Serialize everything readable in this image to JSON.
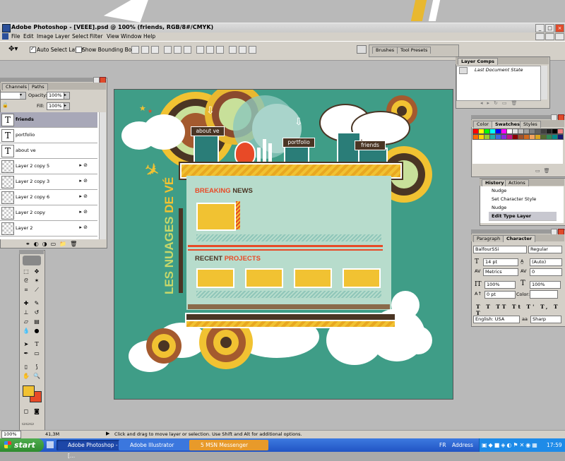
{
  "window": {
    "title": "Adobe Photoshop - [VEEE].psd @ 100% (friends, RGB/8#/CMYK)"
  },
  "menu": [
    "File",
    "Edit",
    "Image",
    "Layer",
    "Select",
    "Filter",
    "View",
    "Window",
    "Help"
  ],
  "options": {
    "auto_select": "Auto Select Layer",
    "show_bounding": "Show Bounding Box",
    "wells": [
      "Brushes",
      "Tool Presets"
    ]
  },
  "layers_palette": {
    "tabs": [
      "Channels",
      "Paths"
    ],
    "opacity_label": "Opacity:",
    "opacity_value": "100%",
    "fill_label": "Fill:",
    "fill_value": "100%",
    "rows": [
      {
        "name": "friends",
        "type": "T"
      },
      {
        "name": "portfolio",
        "type": "T"
      },
      {
        "name": "about ve",
        "type": "T"
      },
      {
        "name": "Layer 2 copy 5",
        "type": "img"
      },
      {
        "name": "Layer 2 copy 3",
        "type": "img"
      },
      {
        "name": "Layer 2 copy 6",
        "type": "img"
      },
      {
        "name": "Layer 2 copy",
        "type": "img"
      },
      {
        "name": "Layer 2",
        "type": "img"
      }
    ]
  },
  "layer_comps": {
    "title": "Layer Comps",
    "item": "Last Document State"
  },
  "swatches": {
    "tabs": [
      "Color",
      "Swatches",
      "Styles"
    ],
    "colors": [
      "#ff0000",
      "#ffff00",
      "#00ff00",
      "#00ffff",
      "#0000ff",
      "#ff00ff",
      "#ffffff",
      "#e0e0e0",
      "#c0c0c0",
      "#a0a0a0",
      "#808080",
      "#606060",
      "#404040",
      "#202020",
      "#000000",
      "#f08080",
      "#ff6a00",
      "#ffd700",
      "#9acd32",
      "#20b2aa",
      "#4169e1",
      "#8a2be2",
      "#c71585",
      "#8b0000",
      "#a0522d",
      "#d2691e",
      "#f4a460",
      "#daa520",
      "#556b2f",
      "#2e8b57",
      "#008b8b",
      "#191970"
    ]
  },
  "history": {
    "tabs": [
      "History",
      "Actions"
    ],
    "items": [
      "Nudge",
      "Set Character Style",
      "Nudge",
      "Edit Type Layer"
    ]
  },
  "character": {
    "tabs": [
      "Paragraph",
      "Character"
    ],
    "font": "BalfourSSi",
    "style": "Regular",
    "size": "14 pt",
    "leading": "(Auto)",
    "kerning": "Metrics",
    "tracking": "0",
    "vscale": "100%",
    "hscale": "100%",
    "baseline": "0 pt",
    "color_label": "Color:",
    "lang": "English: USA",
    "aa": "Sharp"
  },
  "artwork": {
    "vertical_text_a": "LES NUAGES ",
    "vertical_text_b": "DE VÉ",
    "breaking_a": "BREAKING ",
    "breaking_b": "NEWS",
    "recent_a": "RECENT ",
    "recent_b": "PROJECTS",
    "nav": [
      "about ve",
      "portfolio",
      "friends"
    ]
  },
  "status": {
    "zoom": "100%",
    "size": "41,3M",
    "hint": "Click and drag to move layer or selection.  Use Shift and Alt for additional options."
  },
  "taskbar": {
    "start": "start",
    "tasks": [
      "Adobe Photoshop - [...",
      "Adobe Illustrator",
      "5 MSN Messenger"
    ],
    "lang": "FR",
    "address": "Address",
    "clock": "17:59"
  }
}
